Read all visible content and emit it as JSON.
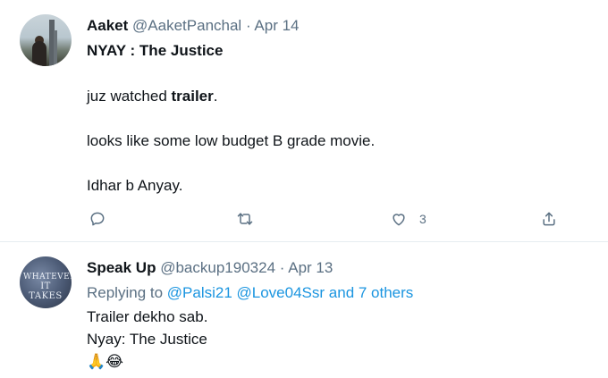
{
  "tweets": [
    {
      "name": "Aaket",
      "handle": "@AaketPanchal",
      "separator": "·",
      "date": "Apr 14",
      "title_part1": "NYAY : ",
      "title_part2": "The Justice",
      "line1_prefix": "juz watched ",
      "line1_bold": "trailer",
      "line1_suffix": ".",
      "line2": "looks like some low budget B grade movie.",
      "line3": "Idhar b Anyay.",
      "actions": {
        "reply_icon": "reply-icon",
        "retweet_icon": "retweet-icon",
        "like_icon": "heart-icon",
        "like_count": "3",
        "share_icon": "share-icon"
      }
    },
    {
      "name": "Speak Up",
      "handle": "@backup190324",
      "separator": "·",
      "date": "Apr 13",
      "avatar_text_1": "WHATEVER",
      "avatar_text_2": "IT TAKES",
      "replying_prefix": "Replying to ",
      "replying_users": "@Palsi21 @Love04Ssr",
      "replying_others": " and 7 others",
      "line1": "Trailer dekho sab.",
      "line2": "Nyay: The Justice",
      "emojis": "🙏😂"
    }
  ],
  "colors": {
    "text": "#0f1419",
    "muted": "#5b7083",
    "link": "#1b95e0",
    "divider": "#e6ecf0"
  }
}
